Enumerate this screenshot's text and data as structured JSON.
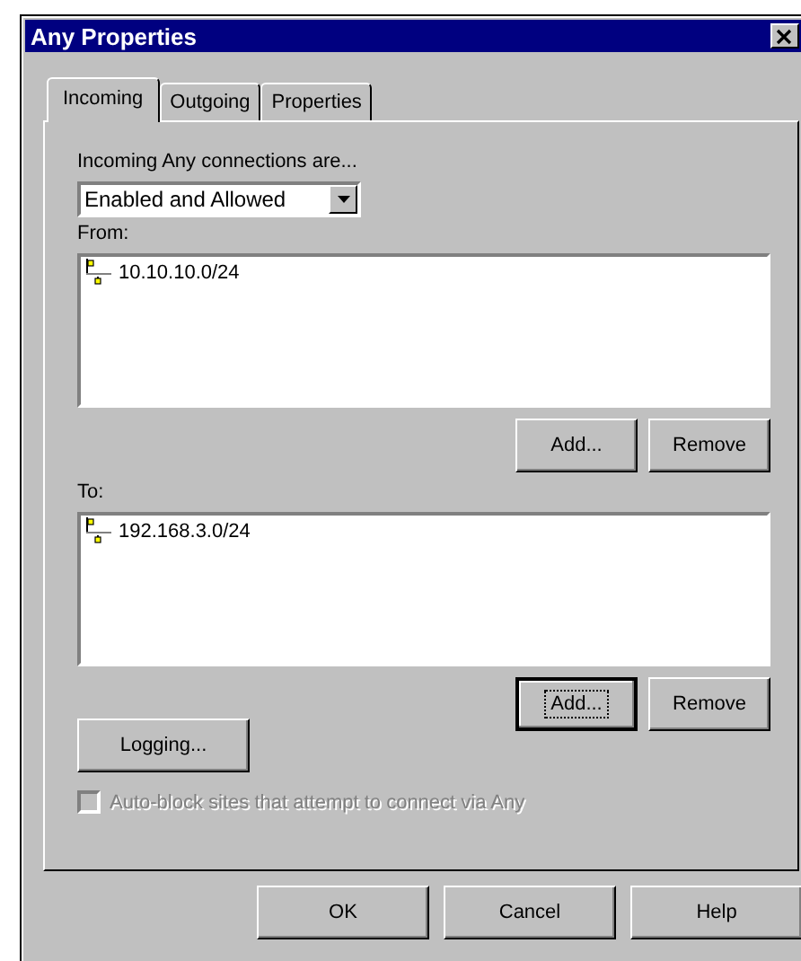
{
  "window": {
    "title": "Any Properties"
  },
  "tabs": [
    {
      "label": "Incoming",
      "selected": true
    },
    {
      "label": "Outgoing",
      "selected": false
    },
    {
      "label": "Properties",
      "selected": false
    }
  ],
  "connections": {
    "label": "Incoming Any connections are...",
    "value": "Enabled and Allowed"
  },
  "lists": [
    {
      "label": "From:",
      "items": [
        "10.10.10.0/24"
      ],
      "buttons": [
        {
          "label": "Add...",
          "focused": false
        },
        {
          "label": "Remove",
          "focused": false
        }
      ]
    },
    {
      "label": "To:",
      "items": [
        "192.168.3.0/24"
      ],
      "buttons": [
        {
          "label": "Add...",
          "focused": true
        },
        {
          "label": "Remove",
          "focused": false
        }
      ]
    }
  ],
  "logging_button": {
    "label": "Logging..."
  },
  "auto_block": {
    "label": "Auto-block sites that attempt to connect via Any",
    "checked": false,
    "disabled": true
  },
  "buttons": [
    {
      "label": "OK"
    },
    {
      "label": "Cancel"
    },
    {
      "label": "Help"
    }
  ]
}
